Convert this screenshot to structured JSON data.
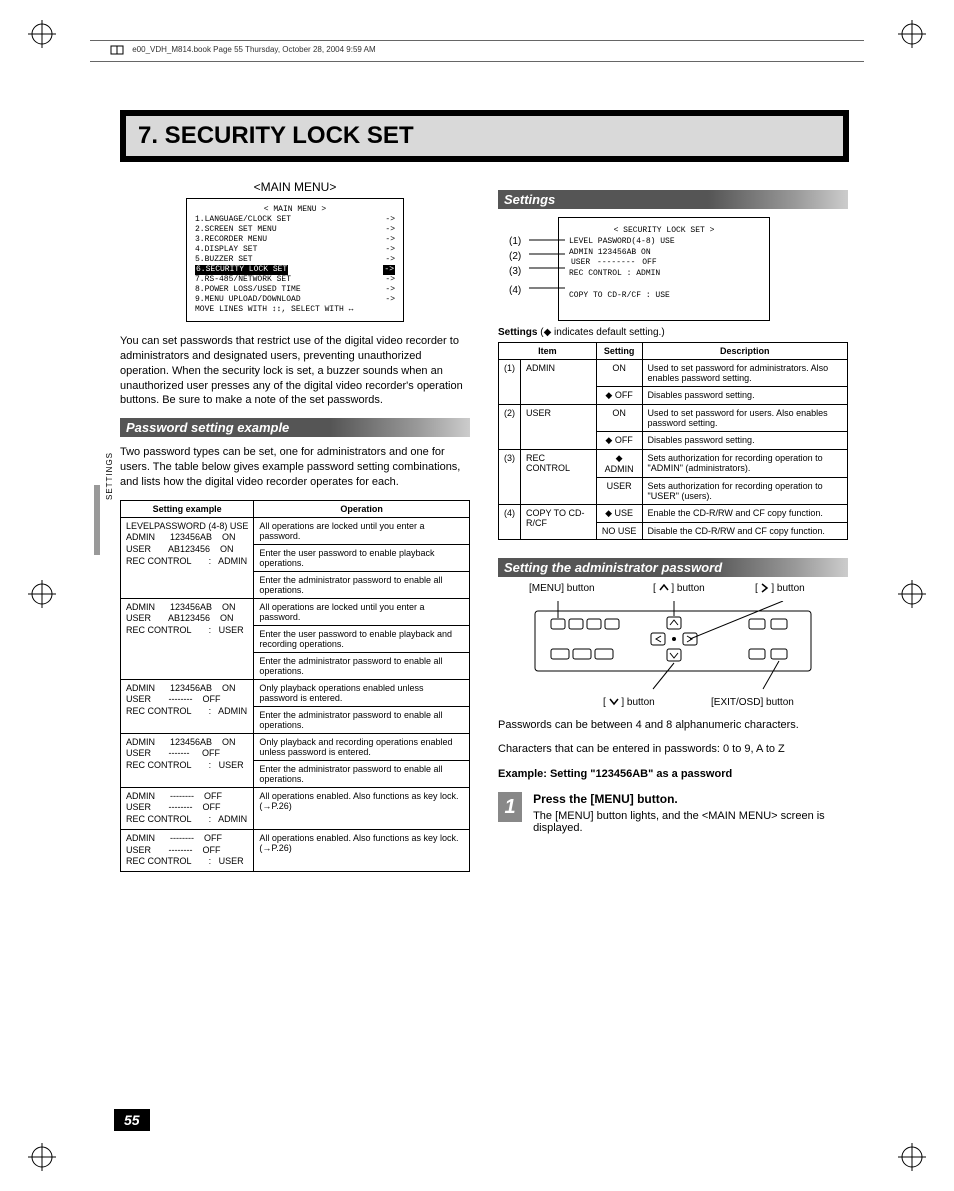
{
  "header_line": "e00_VDH_M814.book  Page 55  Thursday, October 28, 2004  9:59 AM",
  "title": "7. SECURITY LOCK SET",
  "sidetab": "SETTINGS",
  "pagenum": "55",
  "main_menu": {
    "label": "<MAIN MENU>",
    "title": "< MAIN MENU >",
    "items": [
      "1.LANGUAGE/CLOCK SET",
      "2.SCREEN SET MENU",
      "3.RECORDER MENU",
      "4.DISPLAY SET",
      "5.BUZZER SET",
      "6.SECURITY LOCK SET",
      "7.RS-485/NETWORK SET",
      "8.POWER LOSS/USED TIME",
      "9.MENU UPLOAD/DOWNLOAD"
    ],
    "footer": "MOVE LINES WITH ↕↕, SELECT WITH ↔"
  },
  "intro": "You can set passwords that restrict use of the digital video recorder to administrators and designated users, preventing unauthorized operation. When the security lock is set, a buzzer sounds when an unauthorized user presses any of the digital video recorder's operation buttons. Be sure to make a note of the set passwords.",
  "password_section": {
    "heading": "Password setting example",
    "intro": "Two password types can be set, one for administrators and one for users. The table below gives example password setting combinations, and lists how the digital video recorder operates for each.",
    "headers": {
      "left": "Setting example",
      "right": "Operation"
    },
    "rows": [
      {
        "setting": "LEVELPASSWORD (4-8) USE\nADMIN      123456AB    ON\nUSER       AB123456    ON\nREC CONTROL       :   ADMIN",
        "ops": [
          "All operations are locked until you enter a password.",
          "Enter the user password to enable playback operations.",
          "Enter the administrator password to enable all operations."
        ]
      },
      {
        "setting": "ADMIN      123456AB    ON\nUSER       AB123456    ON\nREC CONTROL       :   USER",
        "ops": [
          "All operations are locked until you enter a password.",
          "Enter the user password to enable playback and recording operations.",
          "Enter the administrator password to enable all operations."
        ]
      },
      {
        "setting": "ADMIN      123456AB    ON\nUSER       --------    OFF\nREC CONTROL       :   ADMIN",
        "ops": [
          "Only playback operations enabled unless password is entered.",
          "Enter the administrator password to enable all operations."
        ]
      },
      {
        "setting": "ADMIN      123456AB    ON\nUSER       -------     OFF\nREC CONTROL       :   USER",
        "ops": [
          "Only playback and recording operations enabled unless password is entered.",
          "Enter the administrator password to enable all operations."
        ]
      },
      {
        "setting": "ADMIN      --------    OFF\nUSER       --------    OFF\nREC CONTROL       :   ADMIN",
        "ops": [
          "All operations enabled. Also functions as key lock. (→P.26)"
        ]
      },
      {
        "setting": "ADMIN      --------    OFF\nUSER       --------    OFF\nREC CONTROL       :   USER",
        "ops": [
          "All operations enabled. Also functions as key lock. (→P.26)"
        ]
      }
    ]
  },
  "settings_section": {
    "heading": "Settings",
    "screenshot": {
      "title": "< SECURITY LOCK SET >",
      "header": "LEVEL   PASWORD(4-8)  USE",
      "lines": [
        "ADMIN     123456AB    ON",
        "USER      --------   OFF",
        "REC CONTROL     :   ADMIN",
        "",
        "COPY TO CD-R/CF :    USE"
      ],
      "labels": [
        "(1)",
        "(2)",
        "(3)",
        "(4)"
      ]
    },
    "caption": "Settings (◆ indicates default setting.)",
    "headers": {
      "item": "Item",
      "setting": "Setting",
      "desc": "Description"
    },
    "rows": [
      {
        "num": "(1)",
        "item": "ADMIN",
        "settings": [
          {
            "s": "ON",
            "d": "Used to set password for administrators. Also enables password setting."
          },
          {
            "s": "◆ OFF",
            "d": "Disables password setting."
          }
        ]
      },
      {
        "num": "(2)",
        "item": "USER",
        "settings": [
          {
            "s": "ON",
            "d": "Used to set password for users. Also enables password setting."
          },
          {
            "s": "◆ OFF",
            "d": "Disables password setting."
          }
        ]
      },
      {
        "num": "(3)",
        "item": "REC CONTROL",
        "settings": [
          {
            "s": "◆ ADMIN",
            "d": "Sets authorization for recording operation to \"ADMIN\" (administrators)."
          },
          {
            "s": "USER",
            "d": "Sets authorization for recording operation to \"USER\" (users)."
          }
        ]
      },
      {
        "num": "(4)",
        "item": "COPY TO CD-R/CF",
        "settings": [
          {
            "s": "◆ USE",
            "d": "Enable the CD-R/RW and CF copy function."
          },
          {
            "s": "NO USE",
            "d": "Disable the CD-R/RW and CF copy function."
          }
        ]
      }
    ]
  },
  "admin_pw_section": {
    "heading": "Setting the administrator password",
    "labels": {
      "menu": "[MENU] button",
      "up": "[     ] button",
      "right": "[     ] button",
      "down": "[     ] button",
      "exit": "[EXIT/OSD] button"
    },
    "p1": "Passwords can be between 4 and 8 alphanumeric characters.",
    "p2": "Characters that can be entered in passwords: 0 to 9, A to Z",
    "example": "Example: Setting \"123456AB\" as a password",
    "step1": {
      "num": "1",
      "title": "Press the [MENU] button.",
      "body": "The [MENU] button lights, and the <MAIN MENU> screen is displayed."
    }
  }
}
